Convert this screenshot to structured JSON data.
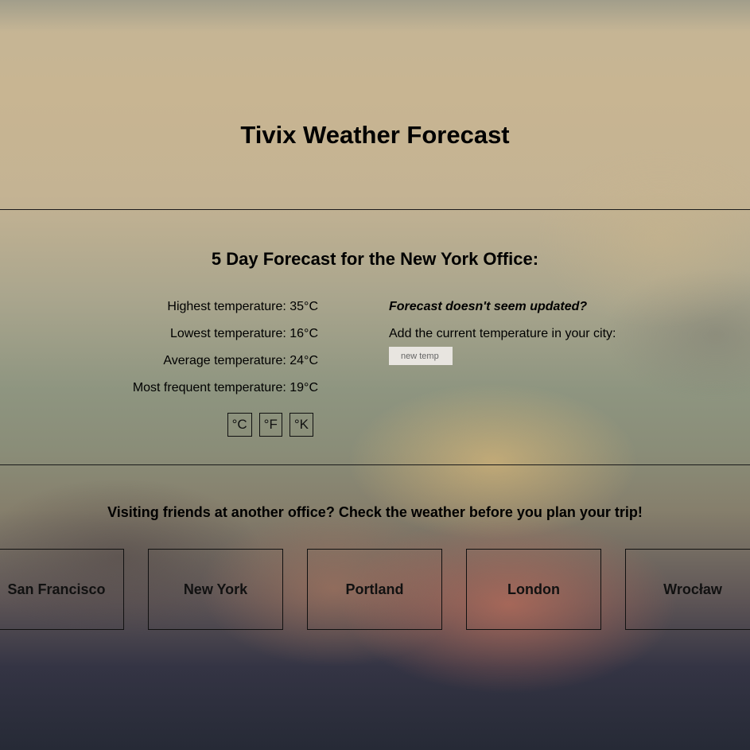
{
  "header": {
    "title": "Tivix Weather Forecast"
  },
  "forecast": {
    "heading": "5 Day Forecast for the New York Office:",
    "stats": [
      "Highest temperature: 35°C",
      "Lowest temperature: 16°C",
      "Average temperature: 24°C",
      "Most frequent temperature: 19°C"
    ],
    "units": [
      "°C",
      "°F",
      "°K"
    ]
  },
  "update": {
    "question": "Forecast doesn't seem updated?",
    "instruction": "Add the current temperature in your city:",
    "input_placeholder": "new temp"
  },
  "offices": {
    "heading": "Visiting friends at another office? Check the weather before you plan your trip!",
    "cities": [
      "San Francisco",
      "New York",
      "Portland",
      "London",
      "Wrocław"
    ]
  }
}
